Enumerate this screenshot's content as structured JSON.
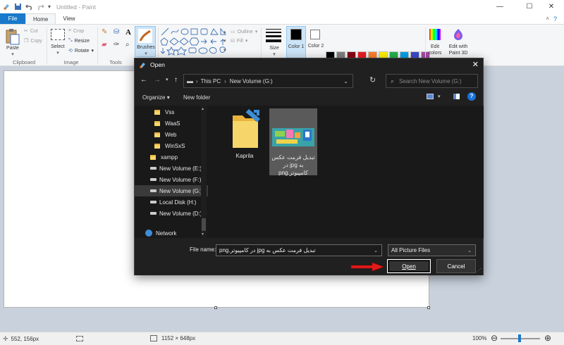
{
  "window": {
    "title": "Untitled - Paint"
  },
  "tabs": {
    "file": "File",
    "home": "Home",
    "view": "View"
  },
  "ribbon": {
    "paste": "Paste",
    "cut": "Cut",
    "copy": "Copy",
    "select": "Select",
    "crop": "Crop",
    "resize": "Resize",
    "rotate": "Rotate",
    "brushes": "Brushes",
    "outline": "Outline",
    "fill": "Fill",
    "size": "Size",
    "color1": "Color 1",
    "color2": "Color 2",
    "edit_colors": "Edit colors",
    "edit_paint3d": "Edit with Paint 3D",
    "groups": {
      "clipboard": "Clipboard",
      "image": "Image",
      "tools": "Tools"
    }
  },
  "colors": {
    "accent": "#1979ca",
    "palette": [
      "#000000",
      "#7f7f7f",
      "#880015",
      "#ed1c24",
      "#ff7f27",
      "#fff200",
      "#22b14c",
      "#00a2e8",
      "#3f48cc",
      "#a349a4",
      "#ffffff",
      "#c3c3c3",
      "#b97a57",
      "#ffaec9",
      "#ffc90e",
      "#efe4b0",
      "#b5e61d",
      "#99d9ea",
      "#7092be",
      "#c8bfe7",
      "#ffffff",
      "#ffffff",
      "#ffffff",
      "#ffffff",
      "#ffffff",
      "#ffffff",
      "#ffffff",
      "#ffffff",
      "#ffffff",
      "#ffffff"
    ]
  },
  "dialog": {
    "title": "Open",
    "path": {
      "items": [
        "This PC",
        "New Volume (G:)"
      ]
    },
    "search_placeholder": "Search New Volume (G:)",
    "organize": "Organize",
    "new_folder": "New folder",
    "tree": [
      {
        "label": "Vss",
        "type": "folder"
      },
      {
        "label": "WaaS",
        "type": "folder"
      },
      {
        "label": "Web",
        "type": "folder"
      },
      {
        "label": "WinSxS",
        "type": "folder"
      },
      {
        "label": "xampp",
        "type": "folder"
      },
      {
        "label": "New Volume (E:)",
        "type": "drive"
      },
      {
        "label": "New Volume (F:)",
        "type": "drive"
      },
      {
        "label": "New Volume (G:)",
        "type": "drive",
        "selected": true
      },
      {
        "label": "Local Disk (H:)",
        "type": "drive"
      },
      {
        "label": "New Volume (D:)",
        "type": "drive"
      },
      {
        "label": "Network",
        "type": "network"
      }
    ],
    "files": [
      {
        "name": "Kaprila",
        "type": "folder"
      },
      {
        "name": "تبدیل فرمت عکس به jpg در کامپیوتر.png",
        "type": "image",
        "selected": true
      }
    ],
    "file_name_label": "File name:",
    "file_name_value": "تبدیل فرمت عکس به jpg در کامپیوتر.png",
    "filter": "All Picture Files",
    "open": "Open",
    "cancel": "Cancel"
  },
  "status": {
    "cursor": "552, 156px",
    "size": "1152 × 648px",
    "zoom": "100%"
  }
}
